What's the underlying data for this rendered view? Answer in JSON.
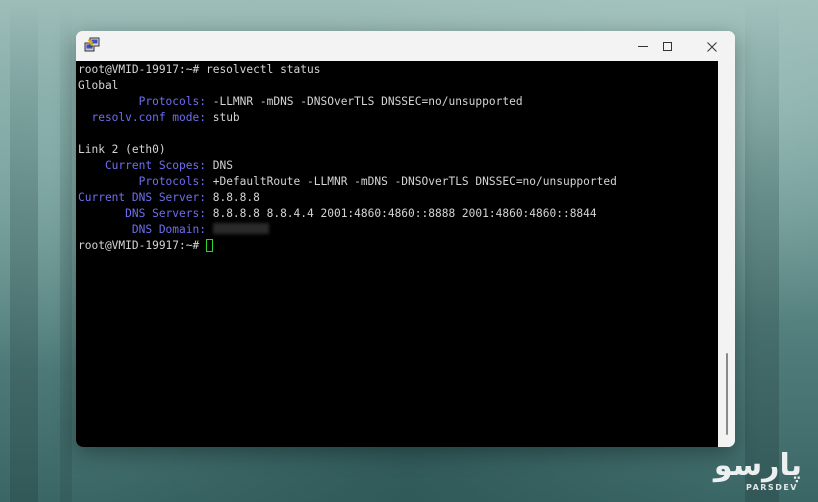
{
  "window": {
    "icon": "putty-icon",
    "controls": [
      "minimize-icon",
      "maximize-icon",
      "close-icon"
    ]
  },
  "terminal": {
    "l1": "root@VMID-19917:~# resolvectl status",
    "l2": "Global",
    "l3_label": "         Protocols:",
    "l3_value": " -LLMNR -mDNS -DNSOverTLS DNSSEC=no/unsupported",
    "l4_label": "  resolv.conf mode:",
    "l4_value": " stub",
    "l6": "Link 2 (eth0)",
    "l7_label": "    Current Scopes:",
    "l7_value": " DNS",
    "l8_label": "         Protocols:",
    "l8_value": " +DefaultRoute -LLMNR -mDNS -DNSOverTLS DNSSEC=no/unsupported",
    "l9_label": "Current DNS Server:",
    "l9_value": " 8.8.8.8",
    "l10_label": "       DNS Servers:",
    "l10_value": " 8.8.8.8 8.8.4.4 2001:4860:4860::8888 2001:4860:4860::8844",
    "l11_label": "        DNS Domain:",
    "prompt": "root@VMID-19917:~# "
  },
  "watermark": {
    "mark": "پارسو",
    "text": "PARSDEV"
  },
  "colors": {
    "label": "#6e6ef0",
    "text": "#d4d4d4",
    "cursor": "#2fd42f",
    "background": "#000000"
  }
}
